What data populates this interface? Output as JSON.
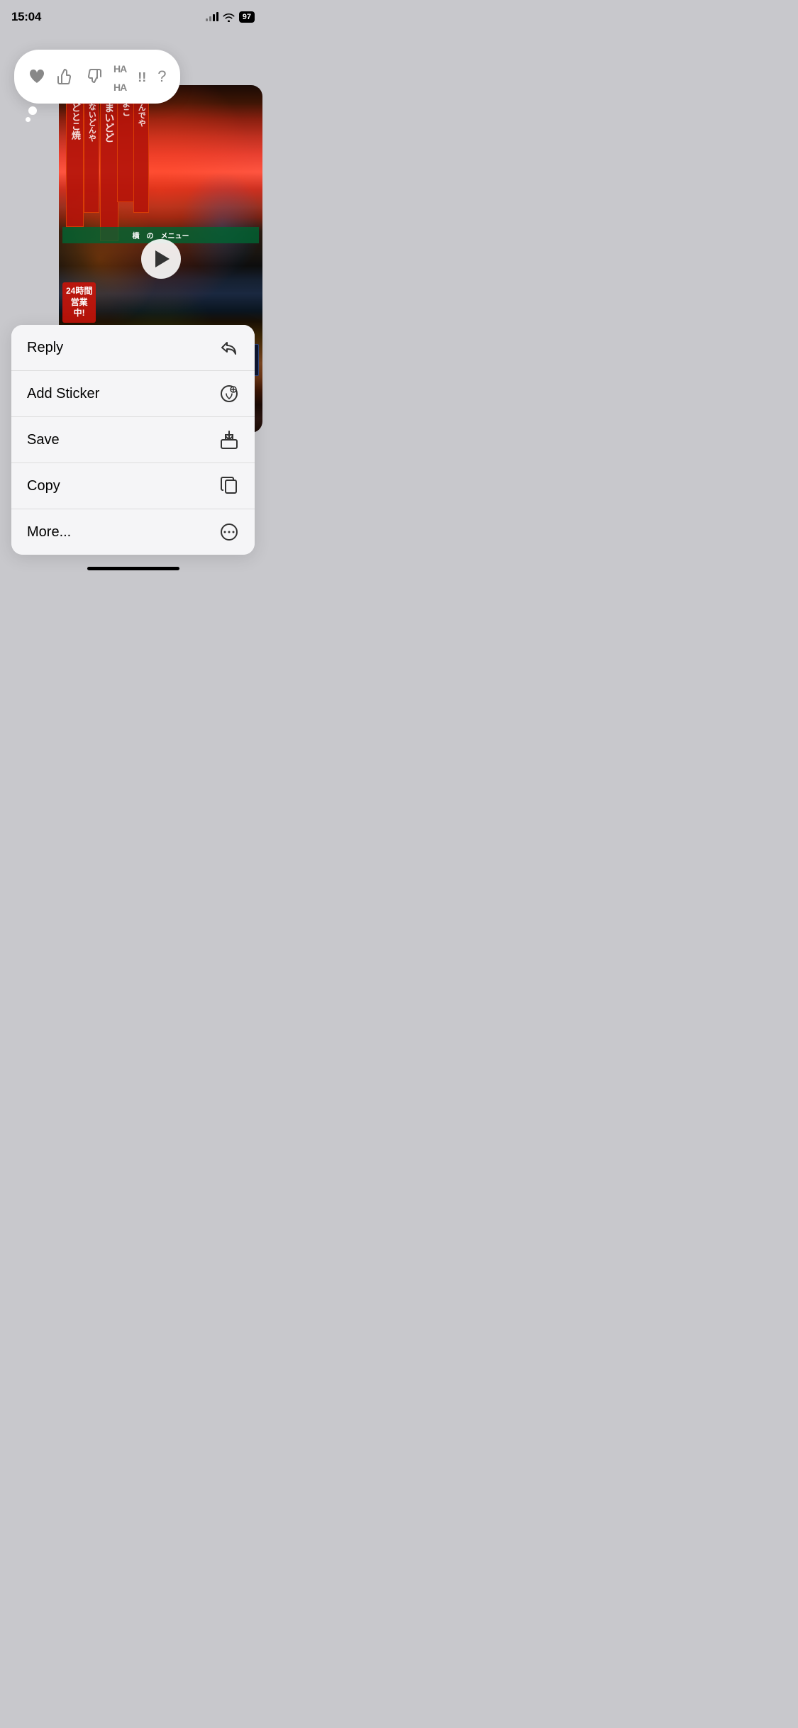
{
  "statusBar": {
    "time": "15:04",
    "battery": "97"
  },
  "reactions": {
    "items": [
      {
        "id": "heart",
        "label": "❤",
        "type": "heart"
      },
      {
        "id": "thumbs-up",
        "label": "👍",
        "type": "thumbs-up"
      },
      {
        "id": "thumbs-down",
        "label": "👎",
        "type": "thumbs-down"
      },
      {
        "id": "haha",
        "label": "HAHA",
        "type": "haha"
      },
      {
        "id": "exclaim",
        "label": "!!",
        "type": "exclaim"
      },
      {
        "id": "question",
        "label": "?",
        "type": "question"
      }
    ]
  },
  "menu": {
    "items": [
      {
        "id": "reply",
        "label": "Reply",
        "icon": "reply"
      },
      {
        "id": "add-sticker",
        "label": "Add Sticker",
        "icon": "sticker"
      },
      {
        "id": "save",
        "label": "Save",
        "icon": "save"
      },
      {
        "id": "copy",
        "label": "Copy",
        "icon": "copy"
      },
      {
        "id": "more",
        "label": "More...",
        "icon": "more"
      }
    ]
  }
}
